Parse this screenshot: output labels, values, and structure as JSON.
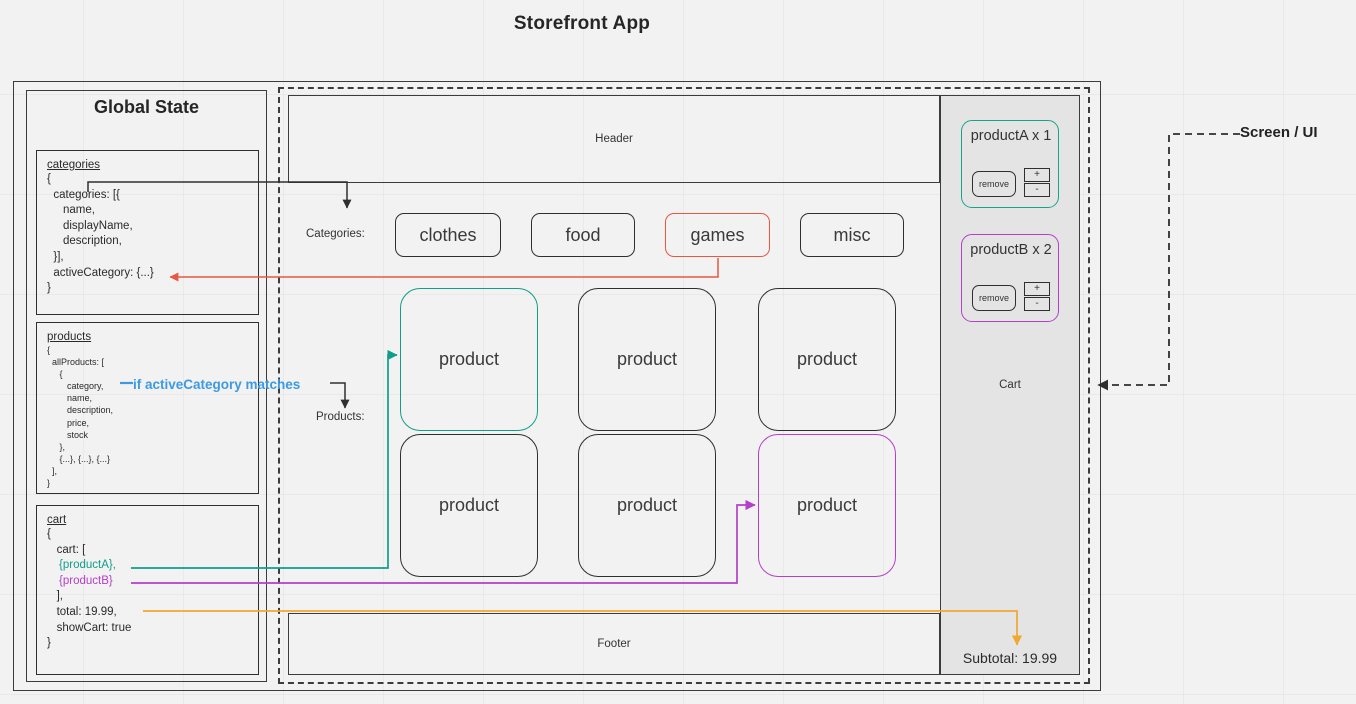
{
  "title": "Storefront App",
  "annotations": {
    "screen_ui": "Screen / UI",
    "blue_note": "if activeCategory matches"
  },
  "global_state": {
    "heading": "Global State",
    "boxes": [
      {
        "name": "categories",
        "lines": [
          "{",
          "  categories: [{",
          "     name,",
          "     displayName,",
          "     description,",
          "  }],",
          "  activeCategory: {...}",
          "}"
        ]
      },
      {
        "name": "products",
        "lines": [
          "{",
          "  allProducts: [",
          "     {",
          "        category,",
          "        name,",
          "        description,",
          "        price,",
          "        stock",
          "     },",
          "     {...}, {...}, {...}",
          "  ],",
          "}"
        ]
      },
      {
        "name": "cart",
        "lines_pre": [
          "{",
          "   cart: ["
        ],
        "item_a": "{productA},",
        "item_b": "{productB}",
        "lines_post": [
          "   ],",
          "   total: 19.99,",
          "   showCart: true",
          "}"
        ]
      }
    ]
  },
  "screen": {
    "header_label": "Header",
    "footer_label": "Footer",
    "categories_label": "Categories:",
    "products_label": "Products:",
    "categories": [
      {
        "label": "clothes",
        "active": false
      },
      {
        "label": "food",
        "active": false
      },
      {
        "label": "games",
        "active": true
      },
      {
        "label": "misc",
        "active": false
      }
    ],
    "products": [
      {
        "label": "product",
        "highlight": "teal"
      },
      {
        "label": "product",
        "highlight": "none"
      },
      {
        "label": "product",
        "highlight": "none"
      },
      {
        "label": "product",
        "highlight": "none"
      },
      {
        "label": "product",
        "highlight": "none"
      },
      {
        "label": "product",
        "highlight": "purple"
      }
    ],
    "cart": {
      "label": "Cart",
      "subtotal": "Subtotal: 19.99",
      "items": [
        {
          "title": "productA x 1",
          "remove_label": "remove",
          "plus_label": "+",
          "minus_label": "-",
          "highlight": "teal"
        },
        {
          "title": "productB x 2",
          "remove_label": "remove",
          "plus_label": "+",
          "minus_label": "-",
          "highlight": "purple"
        }
      ]
    }
  },
  "colors": {
    "teal": "#0f9e8a",
    "purple": "#b43fc8",
    "orange_red": "#e8573f",
    "amber": "#f0a830",
    "blue": "#3d9ae2",
    "ink": "#2f2f2f"
  }
}
